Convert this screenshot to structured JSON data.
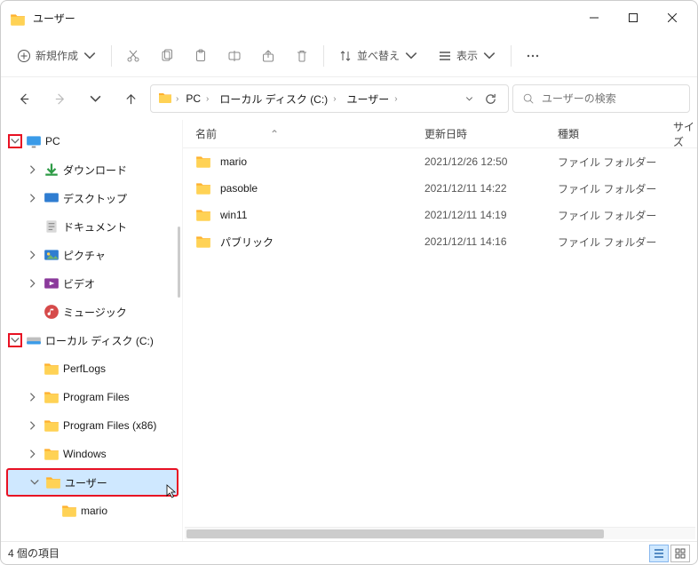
{
  "window": {
    "title": "ユーザー"
  },
  "toolbar": {
    "new": "新規作成",
    "sort": "並べ替え",
    "view": "表示"
  },
  "breadcrumbs": [
    "PC",
    "ローカル ディスク (C:)",
    "ユーザー"
  ],
  "search": {
    "placeholder": "ユーザーの検索"
  },
  "columns": {
    "name": "名前",
    "date": "更新日時",
    "type": "種類",
    "size": "サイズ"
  },
  "rows": [
    {
      "name": "mario",
      "date": "2021/12/26 12:50",
      "type": "ファイル フォルダー"
    },
    {
      "name": "pasoble",
      "date": "2021/12/11 14:22",
      "type": "ファイル フォルダー"
    },
    {
      "name": "win11",
      "date": "2021/12/11 14:19",
      "type": "ファイル フォルダー"
    },
    {
      "name": "パブリック",
      "date": "2021/12/11 14:16",
      "type": "ファイル フォルダー"
    }
  ],
  "tree": {
    "pc": "PC",
    "downloads": "ダウンロード",
    "desktop": "デスクトップ",
    "documents": "ドキュメント",
    "pictures": "ピクチャ",
    "videos": "ビデオ",
    "music": "ミュージック",
    "cdrive": "ローカル ディスク (C:)",
    "perflogs": "PerfLogs",
    "progfiles": "Program Files",
    "progfiles86": "Program Files (x86)",
    "windows": "Windows",
    "users": "ユーザー",
    "mario": "mario"
  },
  "status": {
    "count": "4 個の項目"
  }
}
